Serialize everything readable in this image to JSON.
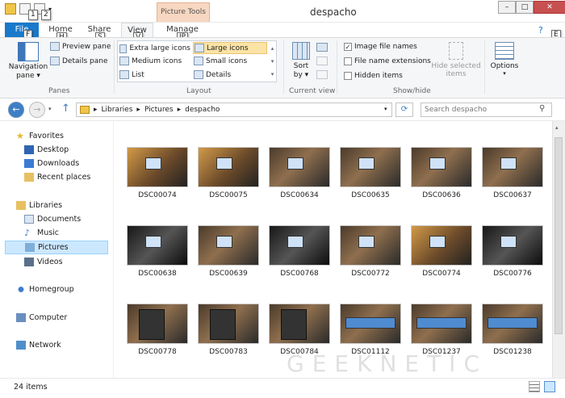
{
  "window": {
    "title": "despacho",
    "context_tab": "Picture Tools",
    "qat_tips": [
      "1",
      "2"
    ],
    "buttons": {
      "minimize": "–",
      "maximize": "□",
      "close": "✕"
    }
  },
  "tabs": [
    {
      "label": "File",
      "key": "F"
    },
    {
      "label": "Home",
      "key": "H"
    },
    {
      "label": "Share",
      "key": "S"
    },
    {
      "label": "View",
      "key": "V"
    },
    {
      "label": "Manage",
      "key": "JP"
    }
  ],
  "help_key": "E",
  "ribbon": {
    "panes": {
      "label": "Panes",
      "navigation_pane": "Navigation pane ▾",
      "preview_pane": "Preview pane",
      "details_pane": "Details pane"
    },
    "layout": {
      "label": "Layout",
      "items": [
        "Extra large icons",
        "Large icons",
        "Medium icons",
        "Small icons",
        "List",
        "Details"
      ],
      "selected": "Large icons"
    },
    "current_view": {
      "label": "Current view",
      "sort_by": "Sort by ▾"
    },
    "show_hide": {
      "label": "Show/hide",
      "image_file_names": "Image file names",
      "image_file_names_checked": true,
      "file_name_extensions": "File name extensions",
      "hidden_items": "Hidden items",
      "hide_selected_items": "Hide selected items"
    },
    "options": "Options"
  },
  "address": {
    "crumbs": [
      "Libraries",
      "Pictures",
      "despacho"
    ],
    "search_placeholder": "Search despacho"
  },
  "nav": {
    "favorites": "Favorites",
    "desktop": "Desktop",
    "downloads": "Downloads",
    "recent": "Recent places",
    "libraries": "Libraries",
    "documents": "Documents",
    "music": "Music",
    "pictures": "Pictures",
    "videos": "Videos",
    "homegroup": "Homegroup",
    "computer": "Computer",
    "network": "Network"
  },
  "files": [
    "DSC00074",
    "DSC00075",
    "DSC00634",
    "DSC00635",
    "DSC00636",
    "DSC00637",
    "DSC00638",
    "DSC00639",
    "DSC00768",
    "DSC00772",
    "DSC00774",
    "DSC00776",
    "DSC00778",
    "DSC00783",
    "DSC00784",
    "DSC01112",
    "DSC01237",
    "DSC01238"
  ],
  "status": {
    "item_count": "24 items"
  },
  "watermark": "GEEKNETIC",
  "colors": {
    "accent": "#1979ca",
    "selected": "#cce8ff",
    "context": "#f7d7c1"
  }
}
